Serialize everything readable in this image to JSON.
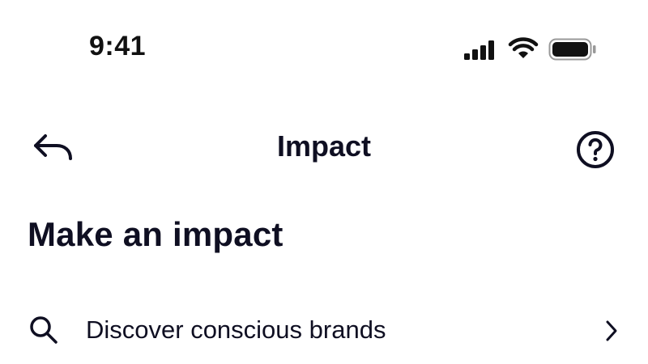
{
  "status_bar": {
    "time": "9:41",
    "icons": [
      "cellular-signal-icon",
      "wifi-icon",
      "battery-icon"
    ]
  },
  "nav": {
    "back_icon": "back-arrow-icon",
    "title": "Impact",
    "help_icon": "help-icon"
  },
  "content": {
    "heading": "Make an impact",
    "items": [
      {
        "icon": "search-icon",
        "label": "Discover conscious brands",
        "trailing_icon": "chevron-right-icon"
      }
    ]
  },
  "colors": {
    "text": "#0f0f22",
    "background": "#ffffff"
  }
}
